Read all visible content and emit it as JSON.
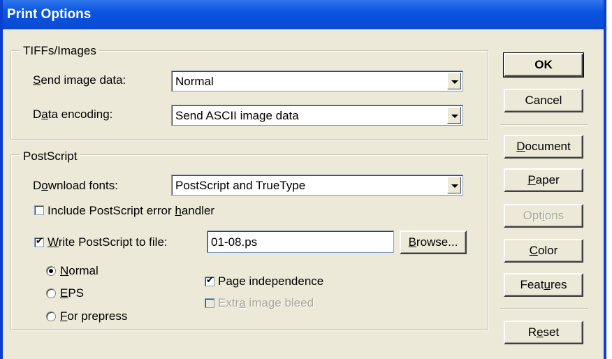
{
  "window": {
    "title": "Print Options"
  },
  "tiffs": {
    "legend": "TIFFs/Images",
    "send_image_data": {
      "label_pre": "",
      "label_u": "S",
      "label_post": "end image data:",
      "value": "Normal"
    },
    "data_encoding": {
      "label_pre": "D",
      "label_u": "a",
      "label_post": "ta encoding:",
      "value": "Send ASCII image data"
    }
  },
  "postscript": {
    "legend": "PostScript",
    "download_fonts": {
      "label_pre": "D",
      "label_u": "o",
      "label_post": "wnload fonts:",
      "value": "PostScript and TrueType"
    },
    "include_error_handler": {
      "label_pre": "Include PostScript error ",
      "label_u": "h",
      "label_post": "andler",
      "checked": false
    },
    "write_to_file": {
      "label_pre": "",
      "label_u": "W",
      "label_post": "rite PostScript to file:",
      "checked": true,
      "filename": "01-08.ps"
    },
    "browse": {
      "label_u": "B",
      "label_post": "rowse..."
    },
    "radios": [
      {
        "label_u": "N",
        "label_post": "ormal",
        "selected": true
      },
      {
        "label_u": "E",
        "label_post": "PS",
        "selected": false
      },
      {
        "label_u": "F",
        "label_post": "or prepress",
        "selected": false
      }
    ],
    "page_independence": {
      "label": "Page independence",
      "checked": true
    },
    "extra_image_bleed": {
      "label_pre": "Extr",
      "label_u": "a",
      "label_post": " image bleed",
      "checked": false,
      "disabled": true
    }
  },
  "buttons": {
    "ok": "OK",
    "cancel": "Cancel",
    "document": {
      "u": "D",
      "post": "ocument"
    },
    "paper": {
      "u": "P",
      "post": "aper"
    },
    "options": {
      "pre": "Opt",
      "u": "i",
      "post": "ons"
    },
    "color": {
      "u": "C",
      "post": "olor"
    },
    "features": {
      "pre": "Feat",
      "u": "u",
      "post": "res"
    },
    "reset": {
      "pre": "R",
      "u": "e",
      "post": "set"
    }
  }
}
